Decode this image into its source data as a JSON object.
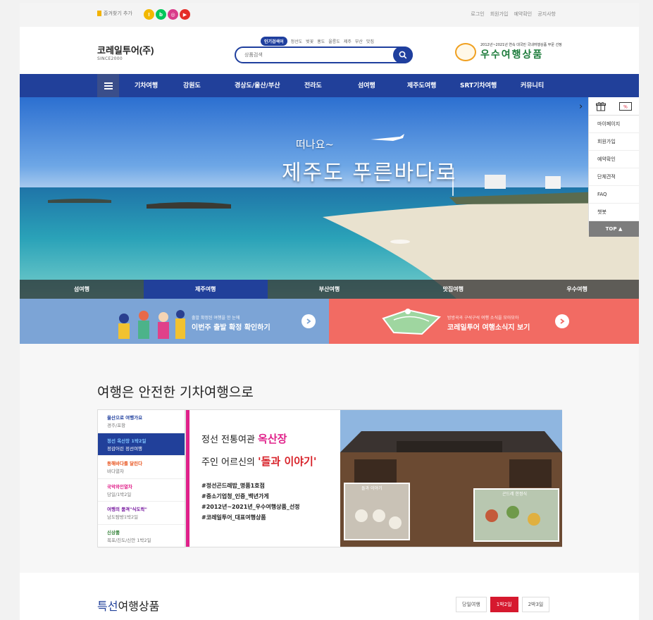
{
  "utility": {
    "bookmark": "즐겨찾기 추가",
    "links": [
      "로그인",
      "회원가입",
      "예약확인",
      "공지사항"
    ]
  },
  "brand": {
    "name": "코레일투어(주)",
    "since": "SINCE2000"
  },
  "search": {
    "badge": "인기검색어",
    "keywords": [
      "정선도",
      "벚꽃",
      "홍도",
      "울릉도",
      "제주",
      "부산",
      "맛집"
    ],
    "placeholder": "상품검색"
  },
  "award": {
    "sub": "2012년~2021년 연속 대국민 국내여행상품 부문 선정",
    "title": "우수여행상품"
  },
  "nav": [
    "기차여행",
    "강원도",
    "경상도/울산/부산",
    "전라도",
    "섬여행",
    "제주도여행",
    "SRT기차여행",
    "커뮤니티"
  ],
  "hero": {
    "sub": "떠나요~",
    "title": "제주도 푸른바다로",
    "tabs": [
      "섬여행",
      "제주여행",
      "부산여행",
      "맛집여행",
      "우수여행"
    ],
    "active_tab": "제주여행"
  },
  "quick": {
    "items": [
      "마이페이지",
      "회원가입",
      "예약확인",
      "단체견적",
      "FAQ",
      "챗봇"
    ],
    "top": "TOP"
  },
  "banners": {
    "blue": {
      "small": "출발 확정된 여행을 한 눈에",
      "big": "이번주 출발 확정 확인하기"
    },
    "red": {
      "small": "방방곡곡 구석구석 여행 소식을 모아모아",
      "big": "코레일투어 여행소식지 보기"
    }
  },
  "train": {
    "title": "여행은 안전한 기차여행으로",
    "items": [
      {
        "title": "울산으로 여행가요",
        "sub": "경주/포항",
        "color": "#1f3f9e"
      },
      {
        "title": "정선 옥산장 1박2일",
        "sub": "정감어린 정선여행",
        "color": "#7ec3ff"
      },
      {
        "title": "동해바다를 달린다",
        "sub": "바다열차",
        "color": "#e8541e"
      },
      {
        "title": "국악와인열차",
        "sub": "당일/1박2일",
        "color": "#e0218a"
      },
      {
        "title": "여행의 품격\"식도락\"",
        "sub": "남도탐방1박2일",
        "color": "#7b1fa2"
      },
      {
        "title": "신상품",
        "sub": "목포/진도/신안 1박2일",
        "color": "#2e7d32"
      }
    ],
    "active_index": 1,
    "panel": {
      "line1_pre": "정선 전통여관 ",
      "line1_em": "옥산장",
      "line2_pre": "주인 어르신의 ",
      "line2_em": "'돌과 이야기'",
      "tags": [
        "#정선곤드레밥_명품1호점",
        "#중소기업청_인증_백년가게",
        "#2012년~2021년_우수여행상품_선정",
        "#코레일투어_대표여행상품"
      ],
      "photo_label_left": "돌과 이야기",
      "photo_label_right": "곤드레 한정식"
    }
  },
  "special": {
    "title_em": "특선",
    "title_rest": "여행상품",
    "tabs": [
      "당일여행",
      "1박2일",
      "2박3일"
    ],
    "active_tab": "1박2일"
  }
}
